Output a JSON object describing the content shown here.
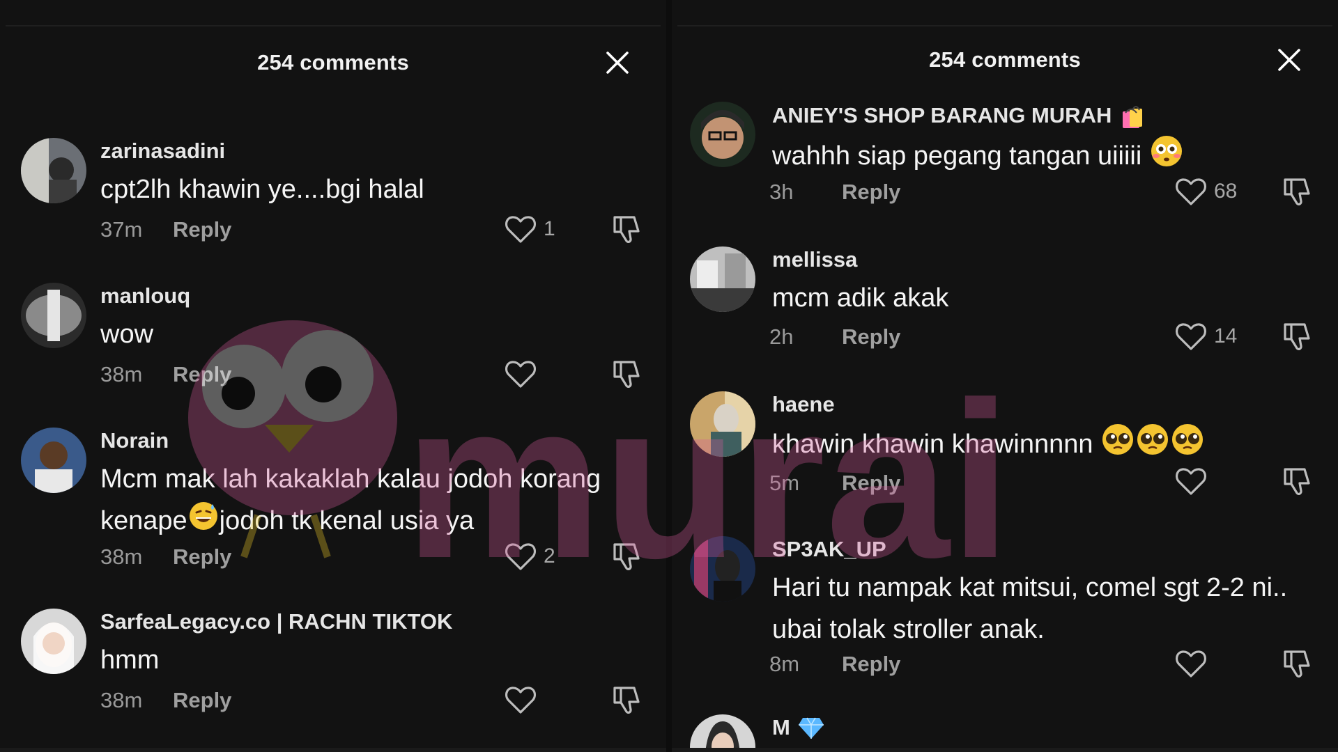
{
  "left_panel": {
    "title": "254 comments",
    "comments": [
      {
        "username": "zarinasadini",
        "text": "cpt2lh khawin ye....bgi halal",
        "time": "37m",
        "reply": "Reply",
        "likes": "1"
      },
      {
        "username": "manlouq",
        "text": "wow",
        "time": "38m",
        "reply": "Reply",
        "likes": ""
      },
      {
        "username": "Norain",
        "text_line1": "Mcm mak lah kakaklah kalau jodoh korang",
        "text_line2a": "kenape",
        "text_line2b": "jodoh tk kenal usia ya",
        "time": "38m",
        "reply": "Reply",
        "likes": "2"
      },
      {
        "username": "SarfeaLegacy.co | RACHN TIKTOK",
        "text": "hmm",
        "time": "38m",
        "reply": "Reply",
        "likes": ""
      }
    ]
  },
  "right_panel": {
    "title": "254 comments",
    "comments": [
      {
        "username": "ANIEY'S SHOP BARANG MURAH",
        "text": "wahhh siap pegang tangan uiiiii",
        "time": "3h",
        "reply": "Reply",
        "likes": "68"
      },
      {
        "username": "mellissa",
        "text": "mcm adik akak",
        "time": "2h",
        "reply": "Reply",
        "likes": "14"
      },
      {
        "username": "haene",
        "text": "khawin khawin khawinnnnn",
        "time": "5m",
        "reply": "Reply",
        "likes": ""
      },
      {
        "username": "SP3AK_UP",
        "text_line1": "Hari tu nampak kat mitsui, comel sgt 2-2 ni..",
        "text_line2": "ubai tolak stroller anak.",
        "time": "8m",
        "reply": "Reply",
        "likes": ""
      },
      {
        "username": "M"
      }
    ]
  },
  "watermark": {
    "text": "murai"
  },
  "icons": {
    "close": "close-icon",
    "like": "heart-outline-icon",
    "dislike": "thumbs-down-icon"
  },
  "colors": {
    "background": "#121212",
    "text": "#f5f5f5",
    "meta": "#9a9a9a"
  }
}
